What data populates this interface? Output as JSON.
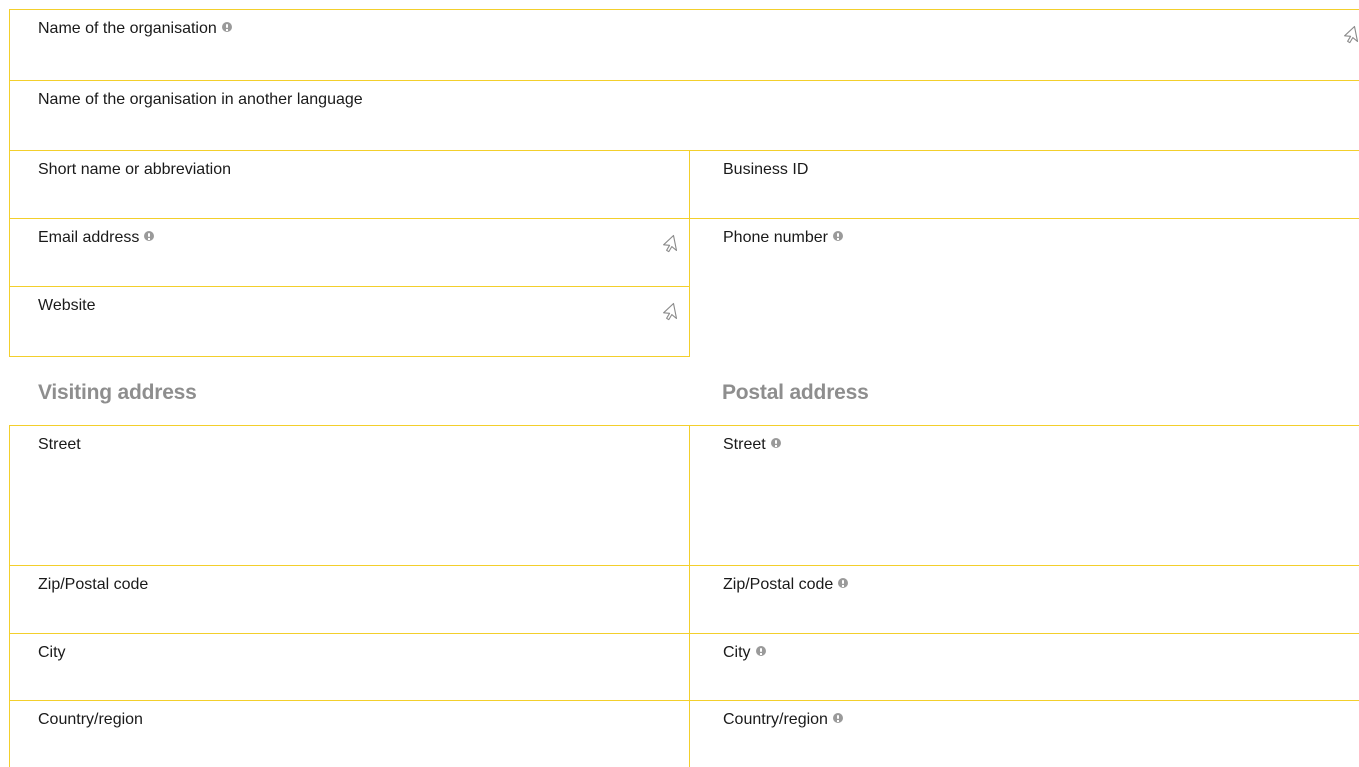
{
  "form": {
    "org_name": {
      "label": "Name of the organisation",
      "value": ""
    },
    "org_name_other_lang": {
      "label": "Name of the organisation in another language",
      "value": ""
    },
    "short_name": {
      "label": "Short name or abbreviation",
      "value": ""
    },
    "business_id": {
      "label": "Business ID",
      "value": ""
    },
    "email": {
      "label": "Email address",
      "value": ""
    },
    "phone": {
      "label": "Phone number",
      "value": ""
    },
    "website": {
      "label": "Website",
      "value": ""
    }
  },
  "visiting_address": {
    "heading": "Visiting address",
    "street": {
      "label": "Street",
      "value": ""
    },
    "zip": {
      "label": "Zip/Postal code",
      "value": ""
    },
    "city": {
      "label": "City",
      "value": ""
    },
    "country": {
      "label": "Country/region",
      "value": ""
    }
  },
  "postal_address": {
    "heading": "Postal address",
    "street": {
      "label": "Street",
      "value": ""
    },
    "zip": {
      "label": "Zip/Postal code",
      "value": ""
    },
    "city": {
      "label": "City",
      "value": ""
    },
    "country": {
      "label": "Country/region",
      "value": ""
    }
  },
  "icons": {
    "link": "link-cursor-icon",
    "required": "required-info-icon"
  },
  "colors": {
    "border": "#f3cf2c",
    "required": "#9a9a9a",
    "heading": "#8e8e8e",
    "text": "#1a1a1a"
  }
}
